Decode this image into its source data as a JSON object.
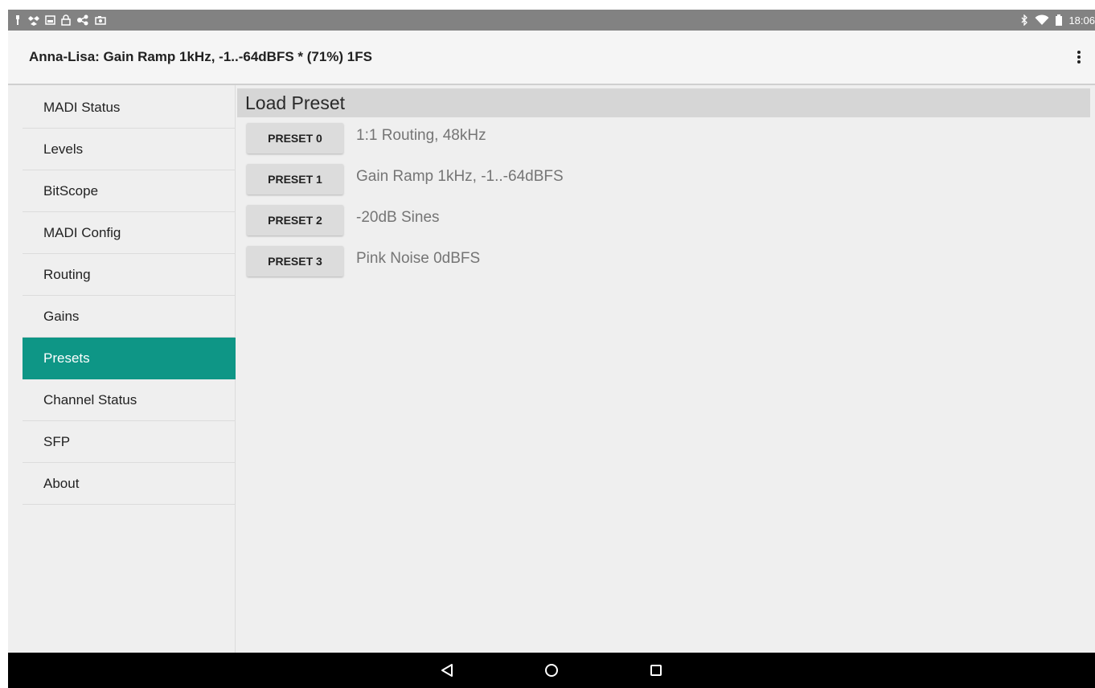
{
  "statusbar": {
    "time": "18:06",
    "left_icons": [
      "usb-icon",
      "dropbox-icon",
      "image-icon",
      "lock-icon",
      "share-icon",
      "photo-icon"
    ],
    "right_icons": [
      "bluetooth-icon",
      "wifi-icon",
      "battery-icon"
    ]
  },
  "appbar": {
    "title": "Anna-Lisa: Gain Ramp 1kHz, -1..-64dBFS * (71%) 1FS",
    "menu_icon": "more-vert-icon"
  },
  "sidebar": {
    "items": [
      {
        "label": "MADI Status"
      },
      {
        "label": "Levels"
      },
      {
        "label": "BitScope"
      },
      {
        "label": "MADI Config"
      },
      {
        "label": "Routing"
      },
      {
        "label": "Gains"
      },
      {
        "label": "Presets"
      },
      {
        "label": "Channel Status"
      },
      {
        "label": "SFP"
      },
      {
        "label": "About"
      }
    ],
    "active": "Presets"
  },
  "main": {
    "section_title": "Load Preset",
    "presets": [
      {
        "button": "PRESET 0",
        "description": "1:1 Routing, 48kHz"
      },
      {
        "button": "PRESET 1",
        "description": "Gain Ramp 1kHz, -1..-64dBFS"
      },
      {
        "button": "PRESET 2",
        "description": "-20dB Sines"
      },
      {
        "button": "PRESET 3",
        "description": "Pink Noise 0dBFS"
      }
    ]
  },
  "navbar": {
    "buttons": [
      "back-icon",
      "home-icon",
      "recents-icon"
    ]
  },
  "colors": {
    "accent": "#0e9686",
    "statusbar": "#828282",
    "navbar": "#000000",
    "content_bg": "#efefef"
  }
}
